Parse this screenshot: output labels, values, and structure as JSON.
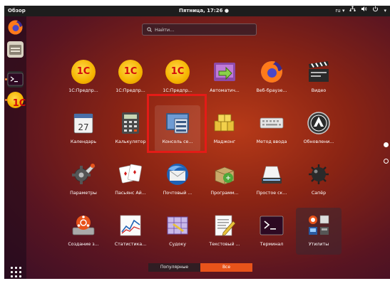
{
  "topbar": {
    "overview_label": "Обзор",
    "clock": "Пятница, 17:26 ●",
    "lang": "ru ▾",
    "tray_icons": [
      "network-icon",
      "volume-icon",
      "power-icon"
    ],
    "tray_arrow": "▾"
  },
  "dock": {
    "items": [
      "firefox-icon",
      "files-icon",
      "terminal-icon",
      "1c-icon"
    ],
    "show_apps": "grid-icon"
  },
  "search": {
    "placeholder": "Найти..."
  },
  "apps": [
    {
      "label": "1С:Предпр...",
      "icon": "1c-icon"
    },
    {
      "label": "1С:Предпр...",
      "icon": "1c-icon"
    },
    {
      "label": "1С:Предпр...",
      "icon": "1c-icon"
    },
    {
      "label": "Автоматич...",
      "icon": "automation-icon"
    },
    {
      "label": "Веб-браузе...",
      "icon": "firefox-icon"
    },
    {
      "label": "Видео",
      "icon": "video-icon"
    },
    {
      "label": "Календарь",
      "icon": "calendar-icon",
      "day": "27"
    },
    {
      "label": "Калькулятор",
      "icon": "calculator-icon"
    },
    {
      "label": "Консоль се...",
      "icon": "server-console-icon"
    },
    {
      "label": "Маджонг",
      "icon": "mahjong-icon"
    },
    {
      "label": "Метод ввода",
      "icon": "keyboard-icon"
    },
    {
      "label": "Обновлени...",
      "icon": "update-icon"
    },
    {
      "label": "Параметры",
      "icon": "settings-icon"
    },
    {
      "label": "Пасьянс Ай...",
      "icon": "cards-icon"
    },
    {
      "label": "Почтовый ...",
      "icon": "mail-icon"
    },
    {
      "label": "Программ...",
      "icon": "software-icon"
    },
    {
      "label": "Простое ск...",
      "icon": "scanner-icon"
    },
    {
      "label": "Сапёр",
      "icon": "mines-icon"
    },
    {
      "label": "Создание з...",
      "icon": "usb-creator-icon"
    },
    {
      "label": "Статистика...",
      "icon": "statistics-icon"
    },
    {
      "label": "Судоку",
      "icon": "sudoku-icon"
    },
    {
      "label": "Текстовый ...",
      "icon": "text-editor-icon"
    },
    {
      "label": "Терминал",
      "icon": "terminal-icon"
    },
    {
      "label": "Утилиты",
      "icon": "utilities-folder-icon"
    }
  ],
  "tabs": {
    "frequent": "Популярные",
    "all": "Все",
    "active": "all"
  },
  "colors": {
    "accent": "#e8531a",
    "highlight": "#e41b17",
    "topbar": "#1d1d1d"
  }
}
